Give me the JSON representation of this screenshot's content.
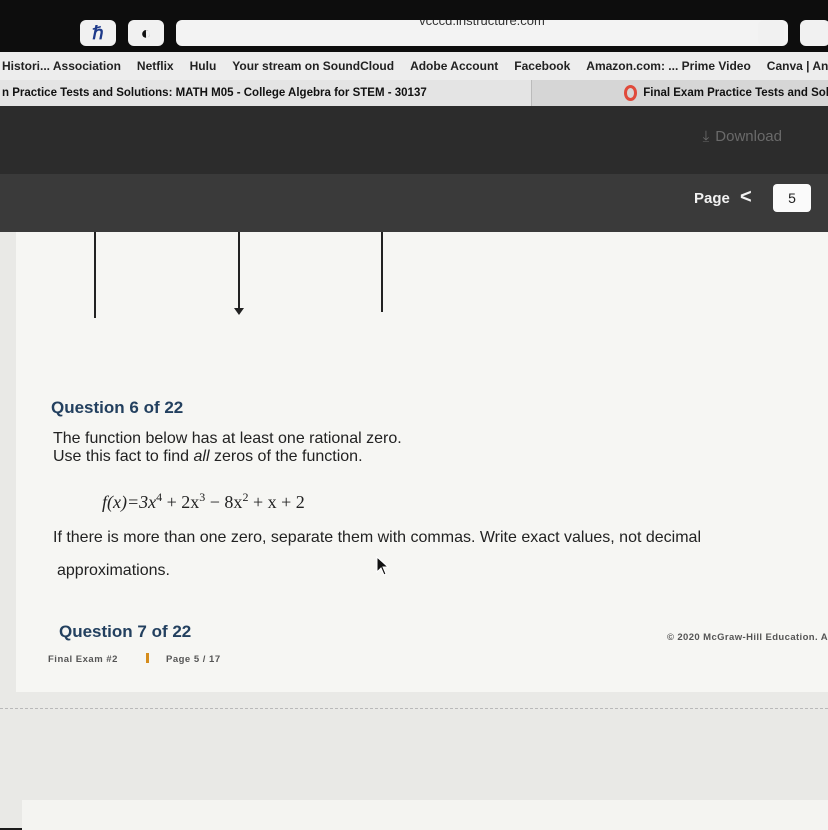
{
  "browser": {
    "url": "vcccd.instructure.com",
    "bookmarks": [
      "Histori... Association",
      "Netflix",
      "Hulu",
      "Your stream on SoundCloud",
      "Adobe Account",
      "Facebook",
      "Amazon.com: ... Prime Video",
      "Canva | An O..."
    ],
    "tabs": [
      {
        "label": "n Practice Tests and Solutions: MATH M05 - College Algebra for STEM - 30137"
      },
      {
        "label": "Final Exam Practice Tests and Sol"
      }
    ]
  },
  "viewer": {
    "download_label": "Download",
    "page_label": "Page",
    "current_page": "5"
  },
  "document": {
    "question6_title": "Question 6 of 22",
    "question6_line1": "The function below has at least one rational zero.",
    "question6_line2_pre": "Use this fact to find ",
    "question6_line2_em": "all",
    "question6_line2_post": " zeros of the function.",
    "formula": {
      "lhs": "f(x)=3x",
      "e4": "4",
      "t2": " + 2x",
      "e3": "3",
      "t3": " − 8x",
      "e2": "2",
      "t4": " + x + 2"
    },
    "instruction_line1": "If there is more than one zero, separate them with commas. Write exact values, not decimal",
    "instruction_line2": "approximations.",
    "question7_title": "Question 7 of 22",
    "footer_left": "Final Exam #2",
    "footer_page": "Page 5 / 17",
    "copyright": "© 2020 McGraw-Hill Education. A"
  }
}
